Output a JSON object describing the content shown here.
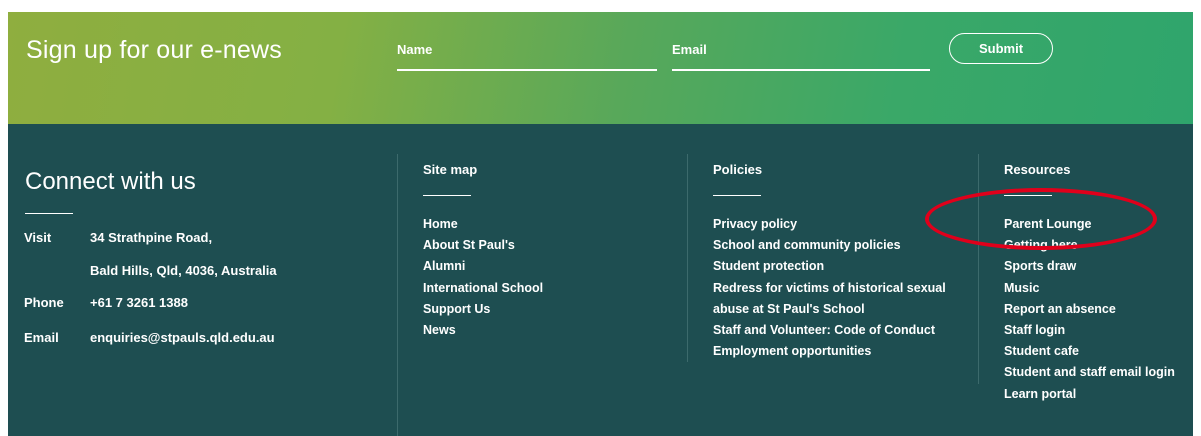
{
  "enews": {
    "title": "Sign up for our e-news",
    "name_placeholder": "Name",
    "email_placeholder": "Email",
    "submit_label": "Submit"
  },
  "connect": {
    "title": "Connect with us",
    "visit_label": "Visit",
    "address_line1": "34 Strathpine Road,",
    "address_line2": "Bald Hills, Qld, 4036, Australia",
    "phone_label": "Phone",
    "phone": "+61 7 3261 1388",
    "email_label": "Email",
    "email": "enquiries@stpauls.qld.edu.au"
  },
  "sitemap": {
    "title": "Site map",
    "items": [
      "Home",
      "About St Paul's",
      "Alumni",
      "International School",
      "Support Us",
      "News"
    ]
  },
  "policies": {
    "title": "Policies",
    "items": [
      "Privacy policy",
      "School and community policies",
      "Student protection",
      "Redress for victims of historical sexual",
      "abuse at St Paul's School",
      "Staff and Volunteer: Code of Conduct",
      "Employment opportunities"
    ]
  },
  "resources": {
    "title": "Resources",
    "items": [
      "Parent Lounge",
      "Getting here",
      "Sports draw",
      "Music",
      "Report an absence",
      "Staff login",
      "Student cafe",
      "Student and staff email login",
      "Learn portal"
    ]
  },
  "annotation_color": "#e0001b"
}
